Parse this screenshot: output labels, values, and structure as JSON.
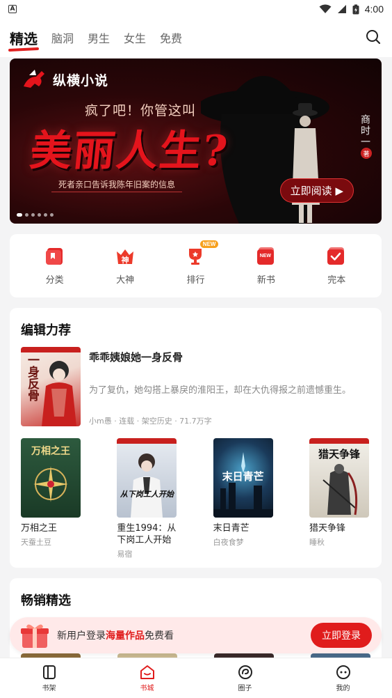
{
  "status_bar": {
    "time": "4:00",
    "left_icon": "A"
  },
  "top_tabs": [
    {
      "label": "精选",
      "active": true
    },
    {
      "label": "脑洞"
    },
    {
      "label": "男生"
    },
    {
      "label": "女生"
    },
    {
      "label": "免费"
    }
  ],
  "banner": {
    "brand": "纵横小说",
    "tagline": "疯了吧！你管这叫",
    "headline": "美丽人生?",
    "subtitle": "死者亲口告诉我陈年旧案的信息",
    "cta": "立即阅读",
    "author": "商时一",
    "author_seal": "著",
    "slides": 6,
    "active_slide": 0
  },
  "quick_entries": [
    {
      "label": "分类",
      "icon": "bookmark-icon"
    },
    {
      "label": "大神",
      "icon": "crown-icon",
      "icon_text": "神"
    },
    {
      "label": "排行",
      "icon": "trophy-icon",
      "badge": "NEW"
    },
    {
      "label": "新书",
      "icon": "new-book-icon",
      "icon_text": "NEW"
    },
    {
      "label": "完本",
      "icon": "check-icon"
    }
  ],
  "editor_pick": {
    "title": "编辑力荐",
    "feature": {
      "title": "乖乖姨娘她一身反骨",
      "desc": "为了复仇，她勾搭上暴戾的淮阳王，却在大仇得报之前遗憾重生。",
      "meta": "小m愚 · 连载 · 架空历史 · 71.7万字",
      "cover_text": "一身反骨"
    },
    "books": [
      {
        "title": "万相之王",
        "author": "天蚕土豆",
        "cover_text": "万相之王"
      },
      {
        "title": "重生1994：从下岗工人开始",
        "author": "易宿",
        "cover_text": "从下岗工人开始"
      },
      {
        "title": "末日青芒",
        "author": "白夜食梦",
        "cover_text": "末日青芒"
      },
      {
        "title": "猎天争锋",
        "author": "睡秋",
        "cover_text": "猎天争锋"
      }
    ]
  },
  "bestsellers": {
    "title": "畅销精选"
  },
  "login_prompt": {
    "text_before": "新用户登录",
    "text_highlight": "海量作品",
    "text_after": "免费看",
    "button": "立即登录"
  },
  "bottom_nav": [
    {
      "label": "书架",
      "icon": "bookshelf-icon"
    },
    {
      "label": "书城",
      "icon": "bookstore-icon",
      "active": true
    },
    {
      "label": "圈子",
      "icon": "circle-icon"
    },
    {
      "label": "我的",
      "icon": "profile-icon"
    }
  ],
  "colors": {
    "accent": "#e01c1c",
    "background": "#f4f4f5",
    "badge": "#f7a01d"
  }
}
